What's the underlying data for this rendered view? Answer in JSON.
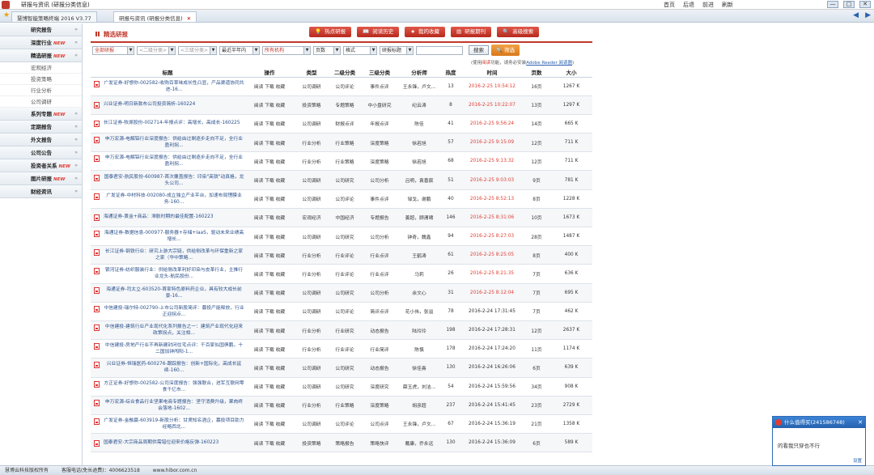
{
  "window": {
    "title": "研报与资讯 (研报分类信息)",
    "nav": [
      "首页",
      "后退",
      "前进",
      "刷新"
    ],
    "controls": [
      "—",
      "□",
      "✕"
    ]
  },
  "tabs": [
    {
      "label": "慧博智能策略终端 2016 V3.77"
    },
    {
      "label": "研报与资讯 (研报分类信息)",
      "close": "✕"
    }
  ],
  "tab_arrows": [
    "◀",
    "▶"
  ],
  "sidebar": {
    "items": [
      {
        "label": "研究报告",
        "new": "",
        "arrow": "»"
      },
      {
        "label": "深度行业",
        "new": "NEW",
        "arrow": "»"
      },
      {
        "label": "精选研报",
        "new": "NEW",
        "arrow": "«"
      },
      {
        "label": "系列专题",
        "new": "NEW",
        "arrow": "»"
      },
      {
        "label": "定期报告",
        "new": "",
        "arrow": "»"
      },
      {
        "label": "外文报告",
        "new": "",
        "arrow": "»"
      },
      {
        "label": "公司公告",
        "new": "",
        "arrow": "»"
      },
      {
        "label": "投资者关系",
        "new": "NEW",
        "arrow": "»"
      },
      {
        "label": "图片研报",
        "new": "NEW",
        "arrow": "»"
      },
      {
        "label": "财经资讯",
        "new": "",
        "arrow": "»"
      }
    ],
    "subitems": [
      "宏观经济",
      "投资策略",
      "行业分析",
      "公司调研"
    ]
  },
  "main": {
    "section_title": "精选研报",
    "top_buttons": [
      {
        "icon": "💡",
        "label": "热点研报"
      },
      {
        "icon": "📖",
        "label": "阅读历史"
      },
      {
        "icon": "★",
        "label": "我的收藏"
      },
      {
        "icon": "▤",
        "label": "研报期刊"
      },
      {
        "icon": "🔍",
        "label": "高级搜索"
      }
    ],
    "filters": {
      "category": "全部研报",
      "sub2": "<二级分类>",
      "sub3": "<三级分类>",
      "period": "最近半年内",
      "org": "所有机构",
      "pages": "页数",
      "format": "格式",
      "field": "研报标题",
      "search_value": "",
      "search_label": "搜索",
      "filter_label": "筛选"
    },
    "note": {
      "prefix": "(使用",
      "em": "阅读",
      "middle": "功能，请务必安装",
      "link": "Adobe Reader 阅读器",
      "suffix": ")"
    },
    "columns": [
      "标题",
      "操作",
      "类型",
      "二级分类",
      "三级分类",
      "分析师",
      "热度",
      "时间",
      "页数",
      "大小"
    ],
    "rows": [
      {
        "title": "广发证券-好想你-002582-收购百草味成长性凸显，产品渠道协同共进-16...",
        "ops": "阅读 下载 收藏",
        "type": "公司调研",
        "c2": "公司评论",
        "c3": "事件点评",
        "analyst": "王永锋，卢文...",
        "heat": "13",
        "time": "2016-2-25 10:54:12",
        "time_red": true,
        "pages": "16页",
        "size": "1267 K"
      },
      {
        "title": "兴业证券-明日新款布公司投资简析-160224",
        "ops": "阅读 下载 收藏",
        "type": "投资策略",
        "c2": "专题策略",
        "c3": "中小盘研究",
        "analyst": "纪云涛",
        "heat": "8",
        "time": "2016-2-25 10:22:07",
        "time_red": true,
        "pages": "13页",
        "size": "1297 K"
      },
      {
        "title": "长江证券-牧原股份-002714-年报点评：高增长，高成长-160225",
        "ops": "阅读 下载 收藏",
        "type": "公司调研",
        "c2": "财报点评",
        "c3": "年报点评",
        "analyst": "陈佳",
        "heat": "41",
        "time": "2016-2-25 9:56:24",
        "time_red": true,
        "pages": "14页",
        "size": "665 K"
      },
      {
        "title": "申万宏源-电解铝行业深度报告：供给由过剩逐步走向不足，全行业盈利拐...",
        "ops": "阅读 下载 收藏",
        "type": "行业分析",
        "c2": "行业策略",
        "c3": "深度策略",
        "analyst": "徐若旭",
        "heat": "57",
        "time": "2016-2-25 9:15:09",
        "time_red": true,
        "pages": "12页",
        "size": "711 K"
      },
      {
        "title": "申万宏源-电解铝行业深度报告：供给由过剩逐步走向不足，全行业盈利拐...",
        "ops": "阅读 下载 收藏",
        "type": "行业分析",
        "c2": "行业策略",
        "c3": "深度策略",
        "analyst": "徐若旭",
        "heat": "68",
        "time": "2016-2-25 9:13:32",
        "time_red": true,
        "pages": "12页",
        "size": "711 K"
      },
      {
        "title": "国泰君安-航民股份-600987-首次覆盖报告：印染\"高铁\"动真格，龙头公司...",
        "ops": "阅读 下载 收藏",
        "type": "公司调研",
        "c2": "公司研究",
        "c3": "公司分析",
        "analyst": "吕明，袁喜宸",
        "heat": "51",
        "time": "2016-2-25 9:03:03",
        "time_red": true,
        "pages": "9页",
        "size": "781 K"
      },
      {
        "title": "广发证券-中材科技-002080-成立独立产业平台，加速布局锂膜业务-160...",
        "ops": "阅读 下载 收藏",
        "type": "公司调研",
        "c2": "公司评论",
        "c3": "事件点评",
        "analyst": "邹戈，谢鹏",
        "heat": "40",
        "time": "2016-2-25 8:52:13",
        "time_red": true,
        "pages": "8页",
        "size": "1228 K"
      },
      {
        "title": "海通证券-黄金+商品：滞胀时期的最佳配置-160223",
        "ops": "阅读 下载 收藏",
        "type": "宏观经济",
        "c2": "中国经济",
        "c3": "专题报告",
        "analyst": "姜超，顾潇啸",
        "heat": "146",
        "time": "2016-2-25 8:31:06",
        "time_red": true,
        "pages": "10页",
        "size": "1673 K"
      },
      {
        "title": "海通证券-数据信息-000977-服务器+存储+IaaS，驱动未来业绩高增长...",
        "ops": "阅读 下载 收藏",
        "type": "公司调研",
        "c2": "公司研究",
        "c3": "公司分析",
        "analyst": "钟奇，魏鑫",
        "heat": "94",
        "time": "2016-2-25 8:27:03",
        "time_red": true,
        "pages": "28页",
        "size": "1487 K"
      },
      {
        "title": "长江证券-钢铁行业：研究上游大宗链，供给侧改革与环保重新之家之家（华中策略...",
        "ops": "阅读 下载 收藏",
        "type": "行业分析",
        "c2": "行业评论",
        "c3": "行业点评",
        "analyst": "王鹤涛",
        "heat": "61",
        "time": "2016-2-25 8:25:05",
        "time_red": true,
        "pages": "8页",
        "size": "400 K"
      },
      {
        "title": "银河证券-纺织服装行业：供给侧改革利好印染与皮革行业，主推行业龙头-航民股份...",
        "ops": "阅读 下载 收藏",
        "type": "行业分析",
        "c2": "行业评论",
        "c3": "行业点评",
        "analyst": "马莉",
        "heat": "26",
        "time": "2016-2-25 8:21:35",
        "time_red": true,
        "pages": "7页",
        "size": "636 K"
      },
      {
        "title": "海通证券-司太立-603520-首家特色原料药企业，具有较大成长前景-16...",
        "ops": "阅读 下载 收藏",
        "type": "公司调研",
        "c2": "公司研究",
        "c3": "公司分析",
        "analyst": "余文心",
        "heat": "31",
        "time": "2016-2-25 8:12:04",
        "time_red": true,
        "pages": "7页",
        "size": "695 K"
      },
      {
        "title": "中信建投-瑞尔特-002790-上市公司新股简评：募投产能释放，行业正迎拐点...",
        "ops": "阅读 下载 收藏",
        "type": "公司调研",
        "c2": "公司评论",
        "c3": "简评点评",
        "analyst": "花小伟，张溢",
        "heat": "78",
        "time": "2016-2-24 17:31:45",
        "time_red": false,
        "pages": "7页",
        "size": "462 K"
      },
      {
        "title": "中信建投-建筑行业产业现代化系列报告之一：建筑产业现代化迎来政策拐点，关注相...",
        "ops": "阅读 下载 收藏",
        "type": "行业分析",
        "c2": "行业研究",
        "c3": "动态报告",
        "analyst": "陆玲玲",
        "heat": "198",
        "time": "2016-2-24 17:28:31",
        "time_red": false,
        "pages": "12页",
        "size": "2637 K"
      },
      {
        "title": "中信建投-房地产行业不再新建封闭住宅点评：千百家似国俱鹏，十二国加钟闯阳-1...",
        "ops": "阅读 下载 收藏",
        "type": "行业分析",
        "c2": "行业评论",
        "c3": "行业简评",
        "analyst": "陈慎",
        "heat": "178",
        "time": "2016-2-24 17:24:20",
        "time_red": false,
        "pages": "11页",
        "size": "1174 K"
      },
      {
        "title": "兴业证券-恒瑞医药-600276-跟踪报告：创新+国际化，高成长延续-160...",
        "ops": "阅读 下载 收藏",
        "type": "公司调研",
        "c2": "公司研究",
        "c3": "动态报告",
        "analyst": "徐佳熹",
        "heat": "130",
        "time": "2016-2-24 16:26:06",
        "time_red": false,
        "pages": "6页",
        "size": "639 K"
      },
      {
        "title": "方正证券-好想你-002582-公司深度报告：强强联合，进军互联网零食千亿市...",
        "ops": "阅读 下载 收藏",
        "type": "公司调研",
        "c2": "公司研究",
        "c3": "深度研究",
        "analyst": "薛玉虎，刘洁...",
        "heat": "54",
        "time": "2016-2-24 15:59:56",
        "time_red": false,
        "pages": "34页",
        "size": "908 K"
      },
      {
        "title": "申万宏源-综合食品行业坚果电商专题报告：坚守消费升级，果肉终会落地-1602...",
        "ops": "阅读 下载 收藏",
        "type": "行业分析",
        "c2": "行业策略",
        "c3": "深度策略",
        "analyst": "胡彦超",
        "heat": "237",
        "time": "2016-2-24 15:41:45",
        "time_red": false,
        "pages": "23页",
        "size": "2729 K"
      },
      {
        "title": "广发证券-金融赢-603919-新股分析：甘肃知名酒企，募投项目助力经略西北...",
        "ops": "阅读 下载 收藏",
        "type": "公司调研",
        "c2": "公司评论",
        "c3": "公司点评",
        "analyst": "王永锋，卢文...",
        "heat": "67",
        "time": "2016-2-24 15:36:19",
        "time_red": false,
        "pages": "21页",
        "size": "1358 K"
      },
      {
        "title": "国泰君安-大宗商品周期供需错位迎来价格反弹-160223",
        "ops": "阅读 下载 收藏",
        "type": "投资策略",
        "c2": "策略报告",
        "c3": "策略快评",
        "analyst": "戴康，乔永远",
        "heat": "130",
        "time": "2016-2-24 15:36:09",
        "time_red": false,
        "pages": "6页",
        "size": "589 K"
      }
    ]
  },
  "statusbar": [
    "慧博云科技版权所有",
    "客服电话(免长途费)：4006623518",
    "www.hibor.com.cn"
  ],
  "popup": {
    "title": "什么值得买(241586748)",
    "close": "✕",
    "body": "的看我只穿也不行",
    "footer": "设置"
  },
  "colors": {
    "accent": "#c0392b",
    "link": "#2a4f8a",
    "time_red": "#e03c31",
    "popup_blue": "#2d6bb5"
  }
}
